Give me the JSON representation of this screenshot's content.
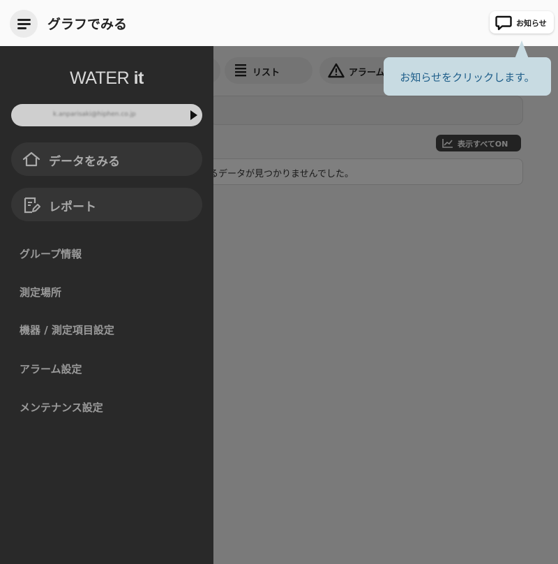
{
  "header": {
    "title": "グラフでみる",
    "notify_label": "お知らせ"
  },
  "tabs": [
    {
      "label": "リスト",
      "icon": "list-icon"
    },
    {
      "label": "アラーム",
      "icon": "warning-icon"
    }
  ],
  "toolbar": {
    "show_all_label": "表示すべてON"
  },
  "content": {
    "empty_message": "するデータが見つかりませんでした。"
  },
  "sidebar": {
    "brand_light": "WATER ",
    "brand_bold": "it",
    "account_email": "k.anparisaki@hiphen.co.jp",
    "buttons": [
      {
        "label": "データをみる",
        "icon": "home-icon"
      },
      {
        "label": "レポート",
        "icon": "report-icon"
      }
    ],
    "links": [
      {
        "label": "グループ情報"
      },
      {
        "label": "測定場所"
      },
      {
        "label": "機器 / 測定項目設定"
      },
      {
        "label": "アラーム設定"
      },
      {
        "label": "メンテナンス設定"
      }
    ]
  },
  "tooltip": {
    "text": "お知らせをクリックします。"
  },
  "colors": {
    "sidebar_bg": "#292929",
    "tooltip_bg": "#c8dbe2",
    "tooltip_text": "#1d5d89",
    "overlay": "rgba(0,0,0,0.5)"
  }
}
